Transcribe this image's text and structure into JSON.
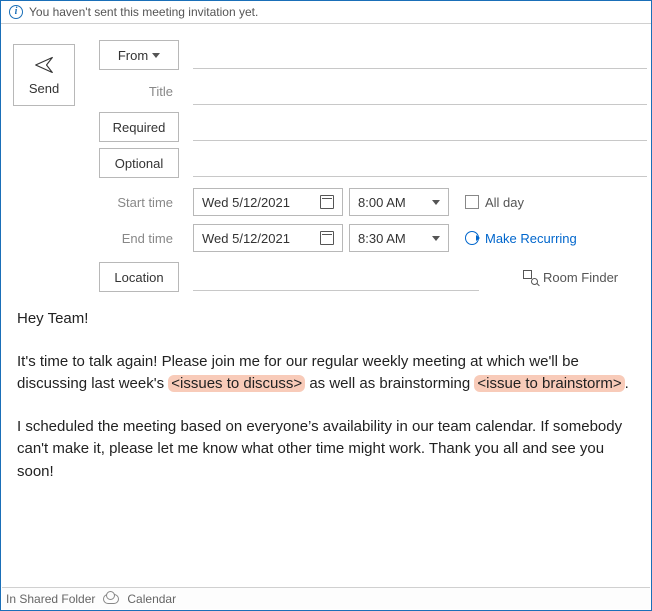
{
  "info_bar": "You haven't sent this meeting invitation yet.",
  "send_label": "Send",
  "labels": {
    "from": "From",
    "title": "Title",
    "required": "Required",
    "optional": "Optional",
    "start_time": "Start time",
    "end_time": "End time",
    "location": "Location",
    "all_day": "All day",
    "make_recurring": "Make Recurring",
    "room_finder": "Room Finder"
  },
  "values": {
    "from": "",
    "title": "",
    "required": "",
    "optional": "",
    "start_date": "Wed 5/12/2021",
    "start_clock": "8:00 AM",
    "end_date": "Wed 5/12/2021",
    "end_clock": "8:30 AM",
    "location": ""
  },
  "body": {
    "greeting": "Hey Team!",
    "p2a": "It's time to talk again! Please join me for our regular weekly meeting at which we'll be discussing last week's ",
    "hl1": "<issues to discuss>",
    "p2b": " as well as brainstorming ",
    "hl2": "<issue to brainstorm>",
    "p2c": ".",
    "p3": "I scheduled the meeting based on everyone’s availability in our team calendar. If somebody can't make it, please let me know what other time might work. Thank you all and see you soon!"
  },
  "status": {
    "folder": "In Shared Folder",
    "context": "Calendar"
  }
}
